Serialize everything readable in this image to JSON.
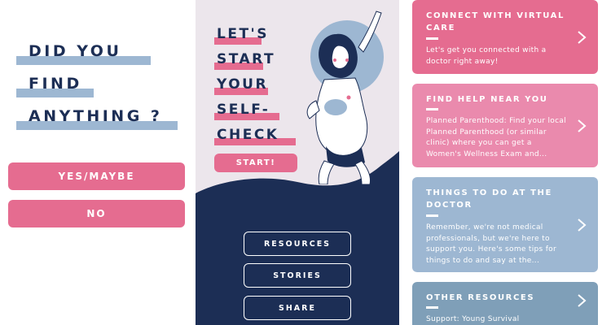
{
  "left": {
    "question_lines": [
      "DID YOU",
      "FIND",
      "ANYTHING ?"
    ],
    "buttons": {
      "yes": "YES/MAYBE",
      "no": "NO"
    }
  },
  "middle": {
    "hero_lines": [
      "LET'S",
      "START",
      "YOUR",
      "SELF-",
      "CHECK"
    ],
    "start_label": "START!",
    "nav": {
      "resources": "RESOURCES",
      "stories": "STORIES",
      "share": "SHARE"
    }
  },
  "cards": [
    {
      "title": "CONNECT WITH VIRTUAL CARE",
      "desc": "Let's get you connected with a doctor right away!",
      "color": "#e56c90"
    },
    {
      "title": "FIND HELP NEAR YOU",
      "desc": "Planned Parenthood: Find your local Planned Parenthood (or similar clinic) where you can get a Women's Wellness Exam and...",
      "color": "#ea8aad"
    },
    {
      "title": "THINGS TO DO AT THE DOCTOR",
      "desc": "Remember, we're not medical professionals, but we're here to support you. Here's some tips for things to do and say at the...",
      "color": "#9db7d2"
    },
    {
      "title": "OTHER RESOURCES",
      "desc": "Support: Young Survival",
      "color": "#7f9fb8"
    }
  ],
  "colors": {
    "navy": "#1c2e55",
    "pink": "#e56c90",
    "blue": "#9db7d2",
    "lavender": "#ece6ec"
  },
  "icons": [
    "chevron-right-icon",
    "self-check-illustration"
  ]
}
